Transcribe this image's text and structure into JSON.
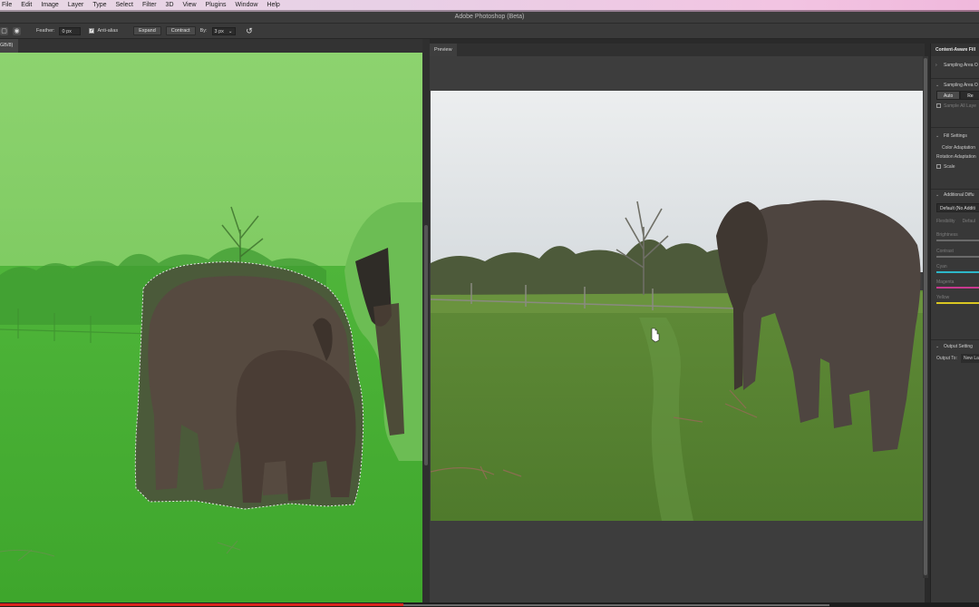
{
  "menu": [
    "File",
    "Edit",
    "Image",
    "Layer",
    "Type",
    "Select",
    "Filter",
    "3D",
    "View",
    "Plugins",
    "Window",
    "Help"
  ],
  "window_title": "Adobe Photoshop (Beta)",
  "options": {
    "feather_label": "Feather:",
    "feather_value": "0 px",
    "antialias_label": "Anti-alias",
    "expand_label": "Expand",
    "contract_label": "Contract",
    "by_label": "By:",
    "by_value": "3 px"
  },
  "doc_tab_label": "GB/8)",
  "preview_tab": "Preview",
  "panel": {
    "title": "Content-Aware Fill",
    "sampling_area_overlay": "Sampling Area O",
    "sampling_area_options": "Sampling Area O",
    "auto_label": "Auto",
    "rect_label": "Re",
    "sample_all_layers": "Sample All Laye",
    "fill_settings": "Fill Settings",
    "color_adaptation": "Color Adaptation",
    "rotation_adaptation": "Rotation Adaptation",
    "scale_label": "Scale",
    "additional_diffusion": "Additional Diffu",
    "default_dropdown": "Default (No Additi",
    "flexibility": "Flexibility",
    "default_right": "Defaul",
    "brightness": "Brightness",
    "contrast": "Contrast",
    "cyan": "Cyan",
    "magenta": "Magenta",
    "yellow": "Yellow",
    "output_settings": "Output Setting",
    "output_to_label": "Output To:",
    "output_to_value": "New Lay"
  },
  "colors": {
    "overlay_green": "#53b83a",
    "cyan": "#2db7c9",
    "magenta": "#c8398f",
    "yellow": "#d9c622",
    "timeline_red": "#d7261f"
  }
}
